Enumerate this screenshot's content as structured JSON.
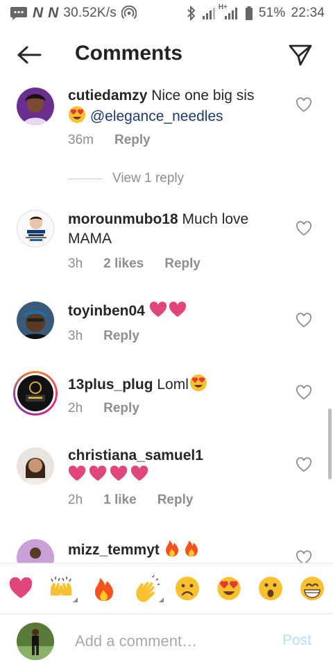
{
  "status_bar": {
    "speed": "30.52K/s",
    "network_label": "H+",
    "battery": "51%",
    "time": "22:34",
    "icons": [
      "message-icon",
      "n-icon",
      "n-icon",
      "hotspot-icon",
      "bluetooth-icon",
      "signal-icon",
      "signal-icon",
      "battery-icon"
    ]
  },
  "header": {
    "title": "Comments",
    "back_icon": "arrow-left-icon",
    "send_icon": "send-icon"
  },
  "comments": [
    {
      "username": "cutiedamzy",
      "text": "Nice one big sis",
      "emoji": "heart-eyes-emoji",
      "mention": "@elegance_needles",
      "time": "36m",
      "likes": "",
      "reply": "Reply",
      "view_replies": "View 1 reply"
    },
    {
      "username": "morounmubo18",
      "text": "Much love MAMA",
      "time": "3h",
      "likes": "2 likes",
      "reply": "Reply"
    },
    {
      "username": "toyinben04",
      "text": "",
      "emoji": "pink-hearts-emoji",
      "time": "3h",
      "likes": "",
      "reply": "Reply"
    },
    {
      "username": "13plus_plug",
      "text": "Loml",
      "emoji": "heart-eyes-emoji",
      "time": "2h",
      "likes": "",
      "reply": "Reply"
    },
    {
      "username": "christiana_samuel1",
      "text": "",
      "emoji": "pink-hearts-emoji",
      "time": "2h",
      "likes": "1 like",
      "reply": "Reply"
    },
    {
      "username": "mizz_temmyt",
      "text": "",
      "emoji": "fire-emoji"
    }
  ],
  "emoji_bar": [
    "red-heart-emoji",
    "raised-hands-emoji",
    "fire-emoji",
    "clapping-hands-emoji",
    "sad-face-emoji",
    "heart-eyes-emoji",
    "surprised-face-emoji",
    "grinning-face-emoji"
  ],
  "input": {
    "placeholder": "Add a comment…",
    "value": "",
    "post_label": "Post"
  },
  "colors": {
    "accent_heart": "#e0457b",
    "mention": "#1e3a6e",
    "post_disabled": "#b2dffc",
    "meta_gray": "#8e8e8e"
  }
}
